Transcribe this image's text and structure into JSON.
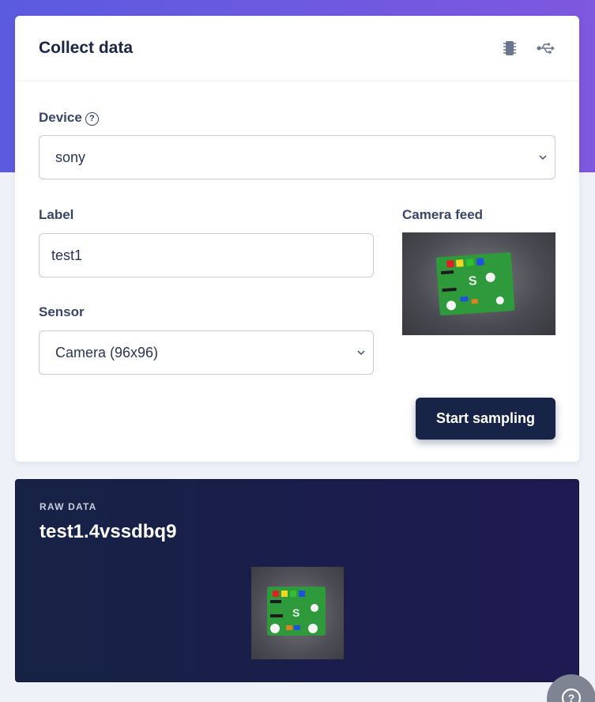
{
  "card": {
    "title": "Collect data",
    "icons": [
      "chip-icon",
      "usb-icon"
    ]
  },
  "device": {
    "label": "Device",
    "help_icon": "?",
    "value": "sony"
  },
  "label_field": {
    "label": "Label",
    "value": "test1"
  },
  "sensor": {
    "label": "Sensor",
    "value": "Camera (96x96)"
  },
  "camera": {
    "label": "Camera feed"
  },
  "actions": {
    "start_label": "Start sampling"
  },
  "raw_data": {
    "caption": "RAW DATA",
    "sample_name": "test1.4vssdbq9"
  },
  "help_fab": {
    "glyph": "?"
  },
  "colors": {
    "accent_gradient_start": "#5b5be0",
    "accent_gradient_end": "#7e58df",
    "primary_button": "#182447",
    "raw_panel": "#172245"
  }
}
